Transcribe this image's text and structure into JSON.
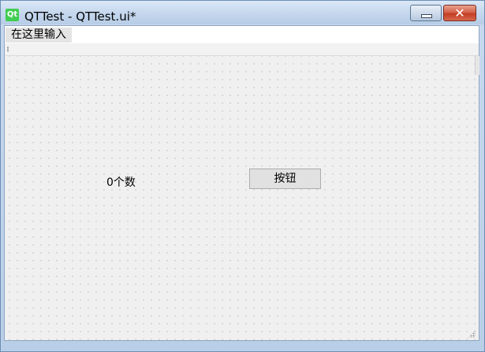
{
  "window": {
    "title": "QTTest - QTTest.ui*",
    "app_icon_text": "Qt",
    "app_icon": "qt-logo-icon",
    "minimize_icon": "minimize-icon",
    "close_icon": "close-icon",
    "close_glyph": "✕",
    "colors": {
      "accent_close": "#c8432a",
      "qt_green": "#41cd52"
    }
  },
  "menubar": {
    "items": [
      {
        "label": "在这里输入"
      }
    ]
  },
  "form": {
    "label_text": "0个数",
    "button_label": "按钮"
  }
}
